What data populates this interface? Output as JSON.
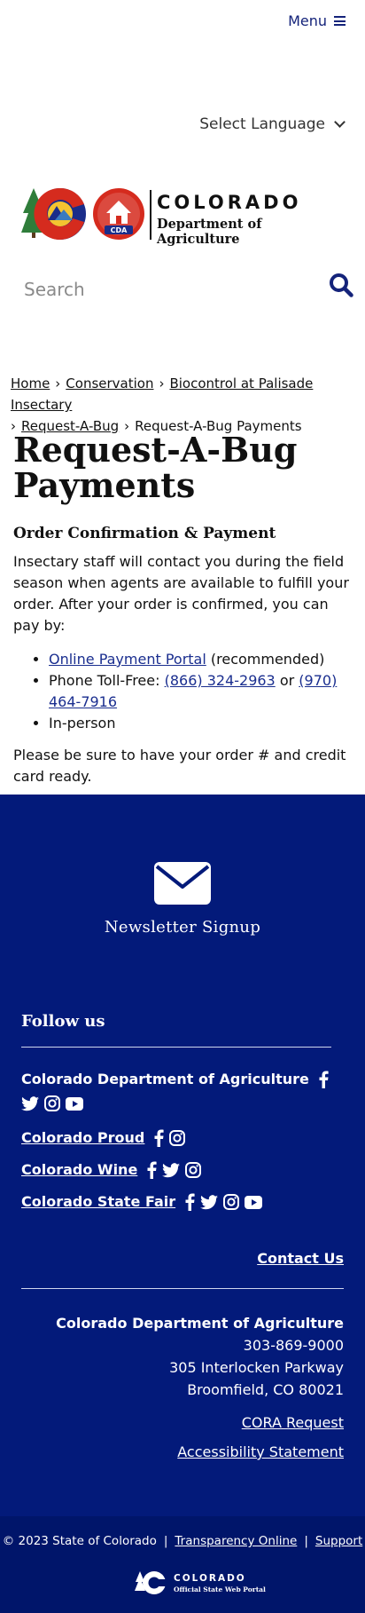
{
  "header": {
    "menu_label": "Menu",
    "language_label": "Select Language",
    "logo": {
      "title": "COLORADO",
      "subtitle": "Department of Agriculture",
      "badge": "CDA"
    },
    "search_placeholder": "Search"
  },
  "breadcrumb": [
    "Home",
    "Conservation",
    "Biocontrol at Palisade Insectary",
    "Request-A-Bug",
    "Request-A-Bug Payments"
  ],
  "main": {
    "title": "Request-A-Bug Payments",
    "subheading": "Order Confirmation & Payment",
    "intro": "Insectary staff will contact you during the field season when agents are available to fulfill your order. After your order is confirmed, you can pay by:",
    "options": {
      "portal_link": "Online Payment Portal",
      "portal_note": "(recommended)",
      "phone_label": "Phone Toll-Free:",
      "phone_1": "(866) 324-2963",
      "phone_or": "or",
      "phone_2": "(970) 464-7916",
      "in_person": "In-person"
    },
    "note": "Please be sure to have your order # and credit card ready."
  },
  "footer": {
    "newsletter_label": "Newsletter Signup",
    "follow_title": "Follow us",
    "social": [
      {
        "name": "Colorado Department of Agriculture",
        "icons": [
          "facebook-icon",
          "twitter-icon",
          "instagram-icon",
          "youtube-icon"
        ]
      },
      {
        "name": "Colorado Proud",
        "icons": [
          "facebook-icon",
          "instagram-icon"
        ]
      },
      {
        "name": "Colorado Wine",
        "icons": [
          "facebook-icon",
          "twitter-icon",
          "instagram-icon"
        ]
      },
      {
        "name": "Colorado State Fair",
        "icons": [
          "facebook-icon",
          "twitter-icon",
          "instagram-icon",
          "youtube-icon"
        ]
      }
    ],
    "contact_label": "Contact Us",
    "address": {
      "org": "Colorado Department of Agriculture",
      "phone": "303-869-9000",
      "street": "305 Interlocken Parkway",
      "city": "Broomfield, CO 80021"
    },
    "cora_label": "CORA Request",
    "accessibility_label": "Accessibility Statement"
  },
  "subfooter": {
    "copyright": "© 2023 State of Colorado",
    "transparency": "Transparency Online",
    "support": "Support",
    "portal_title": "COLORADO",
    "portal_subtitle": "Official State Web Portal"
  },
  "colors": {
    "footer_bg": "#031a7a",
    "subfooter_bg": "#00156a",
    "link": "#1a2e8f",
    "accent_navy": "#14237a"
  }
}
